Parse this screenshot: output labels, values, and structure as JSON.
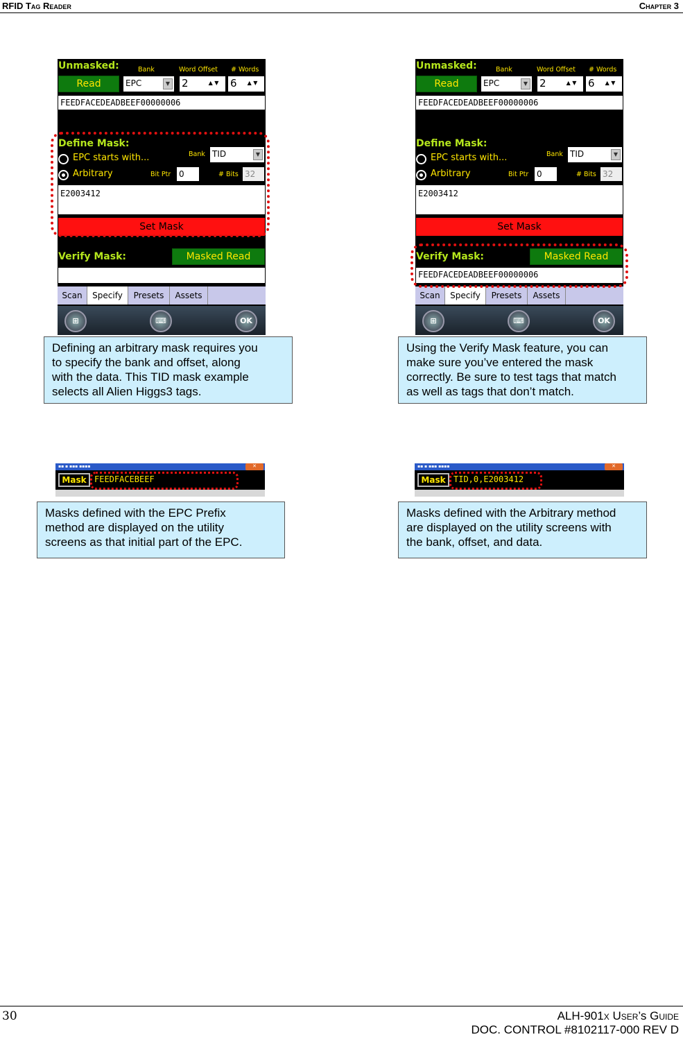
{
  "header": {
    "left_a": "RFID T",
    "left_b": "ag",
    "left_c": " R",
    "left_d": "eader",
    "right_a": "C",
    "right_b": "hapter",
    "right_c": " 3"
  },
  "footer": {
    "page_number": "30",
    "guide_a": "ALH-901",
    "guide_b": "x",
    "guide_c": " U",
    "guide_d": "ser",
    "guide_e": "’s G",
    "guide_f": "uide",
    "doc_control": "DOC. CONTROL #8102117-000 REV D"
  },
  "screen1": {
    "unmasked_label": "Unmasked:",
    "bank_label": "Bank",
    "word_offset_label": "Word Offset",
    "words_label": "# Words",
    "read_button": "Read",
    "bank_value": "EPC",
    "offset_value": "2",
    "words_value": "6",
    "epc_value": "FEEDFACEDEADBEEF00000006",
    "define_mask_label": "Define Mask:",
    "mask_bank_label": "Bank",
    "mask_bank_value": "TID",
    "epc_starts_label": "EPC starts with...",
    "arbitrary_label": "Arbitrary",
    "bit_ptr_label": "Bit Ptr",
    "bit_ptr_value": "0",
    "bits_label": "# Bits",
    "bits_value": "32",
    "mask_data": "E2003412",
    "set_mask_button": "Set Mask",
    "verify_mask_label": "Verify Mask:",
    "masked_read_button": "Masked Read",
    "verify_value": "",
    "tabs": [
      "Scan",
      "Specify",
      "Presets",
      "Assets"
    ],
    "ok_label": "OK"
  },
  "screen2": {
    "unmasked_label": "Unmasked:",
    "bank_label": "Bank",
    "word_offset_label": "Word Offset",
    "words_label": "# Words",
    "read_button": "Read",
    "bank_value": "EPC",
    "offset_value": "2",
    "words_value": "6",
    "epc_value": "FEEDFACEDEADBEEF00000006",
    "define_mask_label": "Define Mask:",
    "mask_bank_label": "Bank",
    "mask_bank_value": "TID",
    "epc_starts_label": "EPC starts with...",
    "arbitrary_label": "Arbitrary",
    "bit_ptr_label": "Bit Ptr",
    "bit_ptr_value": "0",
    "bits_label": "# Bits",
    "bits_value": "32",
    "mask_data": "E2003412",
    "set_mask_button": "Set Mask",
    "verify_mask_label": "Verify Mask:",
    "masked_read_button": "Masked Read",
    "verify_value": "FEEDFACEDEADBEEF00000006",
    "tabs": [
      "Scan",
      "Specify",
      "Presets",
      "Assets"
    ],
    "ok_label": "OK"
  },
  "captions": {
    "c1": [
      "Defining an arbitrary mask requires you",
      "to specify the bank and offset, along",
      "with the data. This TID mask example",
      "selects all Alien Higgs3 tags."
    ],
    "c2": [
      "Using the Verify Mask feature, you can",
      "make sure you’ve entered the mask",
      "correctly. Be sure to test tags that match",
      "as well as tags that don’t match."
    ],
    "c3": [
      "Masks defined with the EPC Prefix",
      "method are displayed on the utility",
      "screens as that initial part of the EPC."
    ],
    "c4": [
      "Masks defined with the Arbitrary method",
      "are displayed on the utility screens with",
      "the bank, offset, and data."
    ]
  },
  "strip1": {
    "mask_label": "Mask",
    "value": "FEEDFACEBEEF"
  },
  "strip2": {
    "mask_label": "Mask",
    "value": "TID,0,E2003412"
  },
  "colors": {
    "caption_bg": "#cdeffd",
    "highlight": "#e01010",
    "set_mask": "#ff1010",
    "green_button": "#0e7a0e",
    "label_green": "#b5e61d",
    "label_yellow": "#ffe600"
  }
}
